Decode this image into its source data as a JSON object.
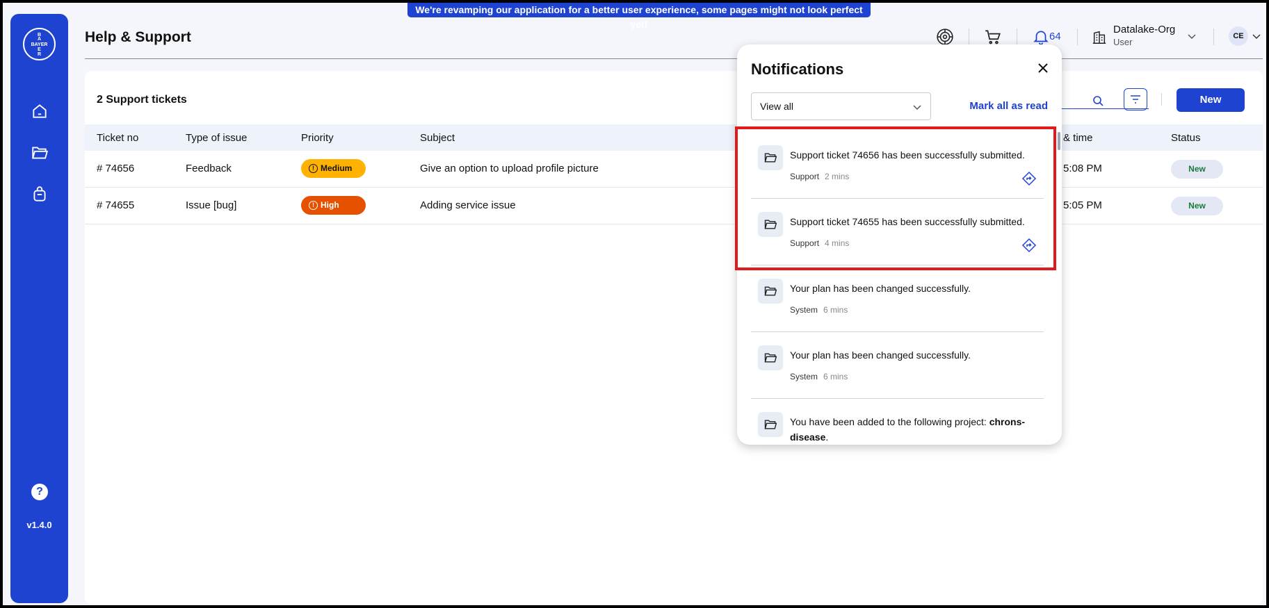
{
  "banner": "We're revamping our application for a better user experience, some pages might not look perfect yet!",
  "sidebar": {
    "logo_text": "BAYER",
    "items": [
      {
        "name": "home-icon"
      },
      {
        "name": "folder-icon"
      },
      {
        "name": "bag-icon"
      }
    ],
    "help": "?",
    "version": "v1.4.0"
  },
  "header": {
    "title": "Help & Support",
    "notification_count": "64",
    "org_name": "Datalake-Org",
    "org_role": "User",
    "avatar_initials": "CE"
  },
  "tickets": {
    "title": "2 Support tickets",
    "new_button": "New",
    "columns": [
      "Ticket no",
      "Type of issue",
      "Priority",
      "Subject",
      "& time",
      "Status"
    ],
    "rows": [
      {
        "ticket_no": "# 74656",
        "type": "Feedback",
        "priority": "Medium",
        "subject": "Give an option to upload profile picture",
        "time": "5:08 PM",
        "status": "New"
      },
      {
        "ticket_no": "# 74655",
        "type": "Issue [bug]",
        "priority": "High",
        "subject": "Adding service issue",
        "time": "5:05 PM",
        "status": "New"
      }
    ]
  },
  "notifications": {
    "title": "Notifications",
    "filter_value": "View all",
    "mark_all": "Mark all as read",
    "items": [
      {
        "text": "Support ticket 74656 has been successfully submitted.",
        "source": "Support",
        "time": "2 mins"
      },
      {
        "text": "Support ticket 74655 has been successfully submitted.",
        "source": "Support",
        "time": "4 mins"
      },
      {
        "text": "Your plan has been changed successfully.",
        "source": "System",
        "time": "6 mins"
      },
      {
        "text": "Your plan has been changed successfully.",
        "source": "System",
        "time": "6 mins"
      },
      {
        "text_prefix": "You have been added to the following project: ",
        "text_bold": "chrons-disease",
        "text_suffix": "."
      }
    ]
  },
  "colors": {
    "brand_blue": "#1f43d1",
    "medium": "#ffb300",
    "high": "#e65100",
    "status_green": "#1b7a3a",
    "highlight_red": "#e01b1b"
  }
}
